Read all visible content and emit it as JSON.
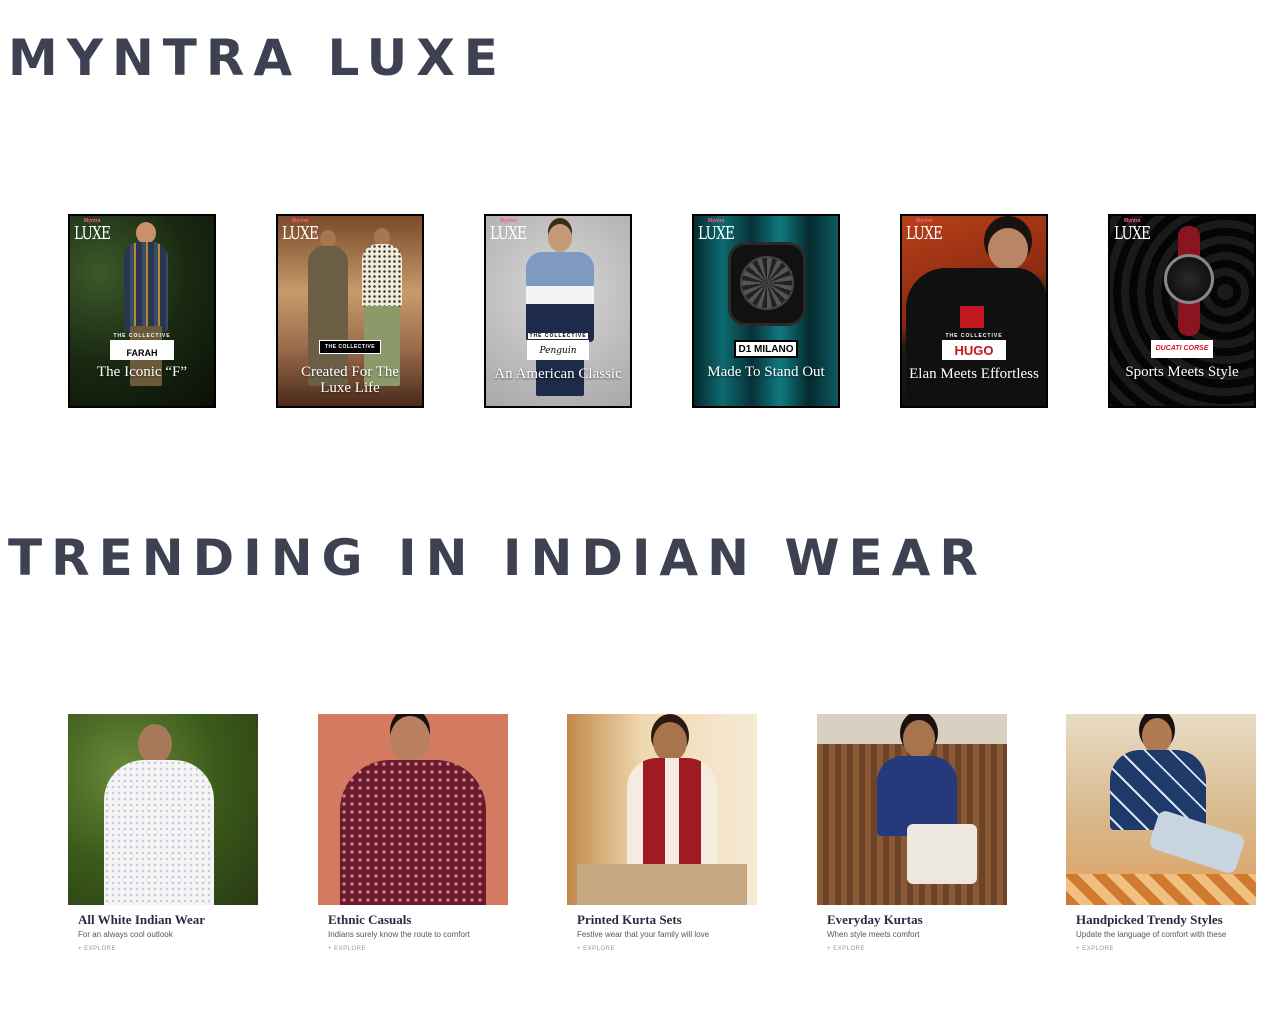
{
  "sections": {
    "luxe": {
      "title": "MYNTRA LUXE",
      "badge_brand": "Myntra",
      "badge_label": "LUXE",
      "cards": [
        {
          "caption": "The Iconic “F”",
          "tag": "THE COLLECTIVE",
          "brand": "FARAH"
        },
        {
          "caption": "Created For The Luxe Life",
          "tag": "THE COLLECTIVE",
          "brand": "THE COLLECTIVE"
        },
        {
          "caption": "An American Classic",
          "tag": "THE COLLECTIVE",
          "brand": "Penguin"
        },
        {
          "caption": "Made To Stand Out",
          "tag": "",
          "brand": "D1 MILANO"
        },
        {
          "caption": "Elan Meets Effortless",
          "tag": "THE COLLECTIVE",
          "brand": "HUGO"
        },
        {
          "caption": "Sports Meets Style",
          "tag": "",
          "brand": "DUCATI CORSE"
        }
      ]
    },
    "indian_wear": {
      "title": "TRENDING IN INDIAN WEAR",
      "explore_label": "+ EXPLORE",
      "cards": [
        {
          "title": "All White Indian Wear",
          "subtitle": "For an always cool outlook"
        },
        {
          "title": "Ethnic Casuals",
          "subtitle": "Indians surely know the route to comfort"
        },
        {
          "title": "Printed Kurta Sets",
          "subtitle": "Festive wear that your family will love"
        },
        {
          "title": "Everyday Kurtas",
          "subtitle": "When style meets comfort"
        },
        {
          "title": "Handpicked Trendy Styles",
          "subtitle": "Update the language of comfort with these"
        }
      ]
    }
  },
  "colors": {
    "heading": "#3e4152",
    "card_border": "#000000",
    "luxe_accent": "#ff3f6c"
  }
}
